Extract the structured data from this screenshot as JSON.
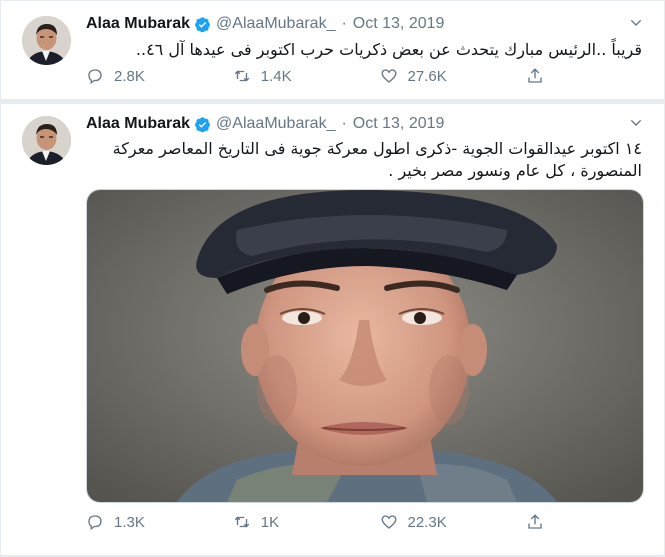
{
  "tweets": [
    {
      "author": "Alaa Mubarak",
      "handle": "@AlaaMubarak_",
      "separator": "·",
      "date": "Oct 13, 2019",
      "text": "قريباً ..الرئيس مبارك يتحدث عن بعض ذكريات حرب اكتوبر فى عيدها آل ٤٦..",
      "replies": "2.8K",
      "retweets": "1.4K",
      "likes": "27.6K"
    },
    {
      "author": "Alaa Mubarak",
      "handle": "@AlaaMubarak_",
      "separator": "·",
      "date": "Oct 13, 2019",
      "text": "١٤ اكتوبر عيدالقوات الجوية -ذكرى اطول معركة جوية فى التاريخ المعاصر معركة المنصورة ، كل عام ونسور مصر بخير .",
      "replies": "1.3K",
      "retweets": "1K",
      "likes": "22.3K"
    }
  ],
  "icons": {
    "verified": "verified-badge-icon",
    "caret": "chevron-down-icon",
    "reply": "reply-icon",
    "retweet": "retweet-icon",
    "like": "heart-icon",
    "share": "share-icon"
  },
  "colors": {
    "verified_blue": "#1da1f2",
    "muted_text": "#657786",
    "divider": "#e6ecf0"
  }
}
